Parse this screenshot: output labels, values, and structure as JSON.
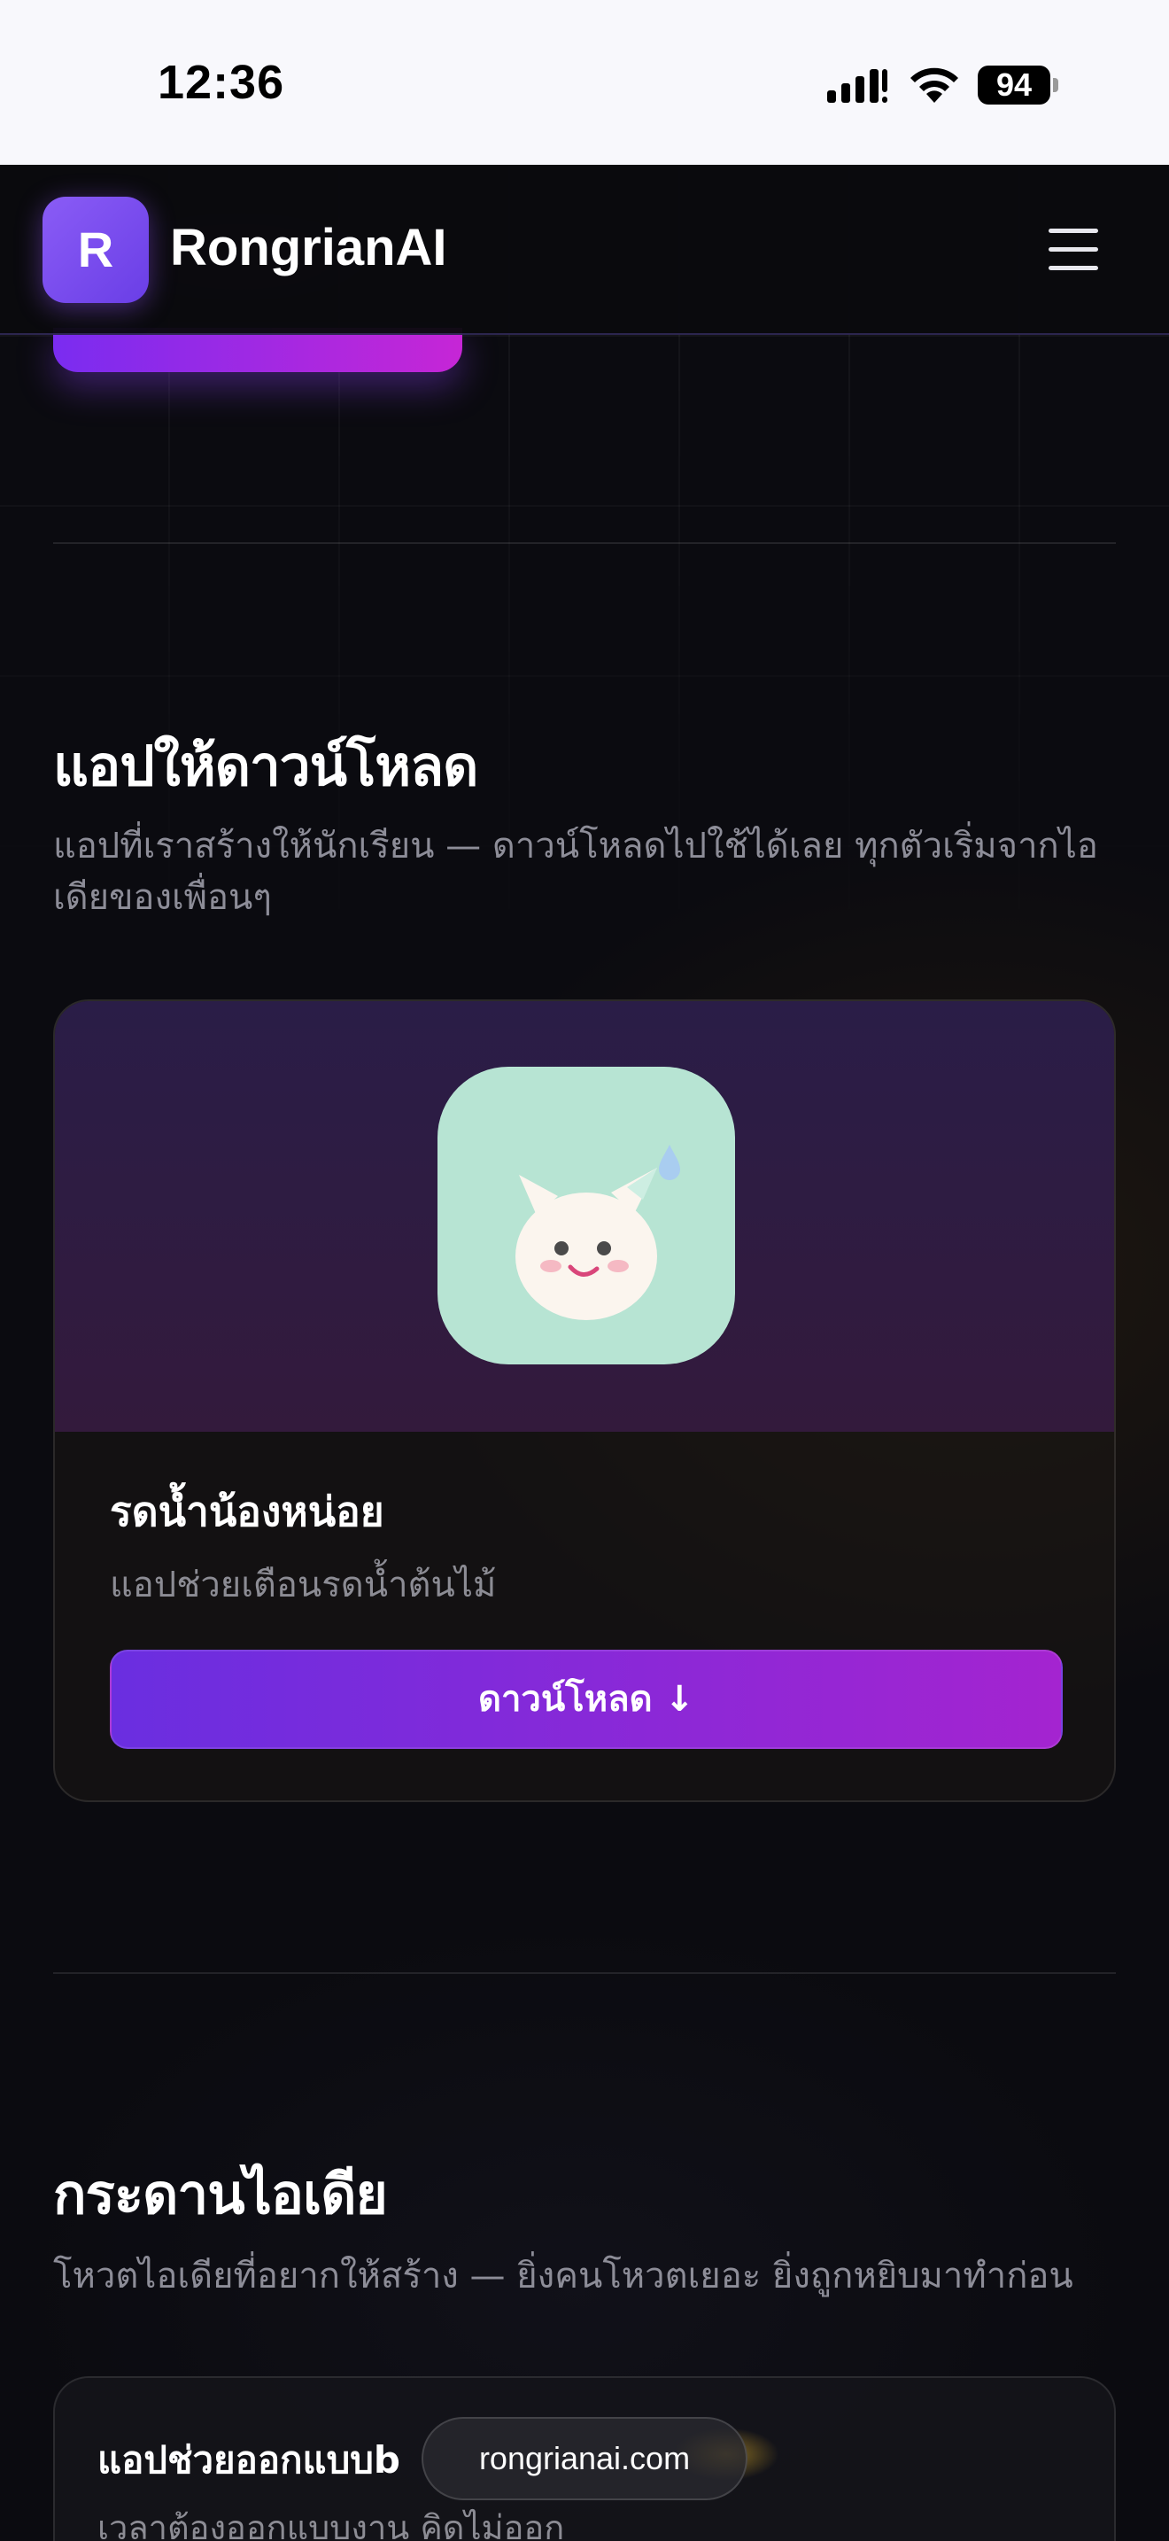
{
  "status_bar": {
    "time": "12:36",
    "battery": "94",
    "icons": [
      "signal-icon",
      "wifi-icon",
      "battery-icon"
    ]
  },
  "header": {
    "logo_letter": "R",
    "brand": "RongrianAI",
    "menu_icon": "hamburger-menu-icon"
  },
  "apps_section": {
    "title": "แอปให้ดาวน์โหลด",
    "description": "แอปที่เราสร้างให้นักเรียน — ดาวน์โหลดไปใช้ได้เลย ทุกตัวเริ่มจากไอเดียของเพื่อนๆ",
    "apps": [
      {
        "name": "รดน้ำน้องหน่อย",
        "description": "แอปช่วยเตือนรดน้ำต้นไม้",
        "download_label": "ดาวน์โหลด ↓",
        "icon": "cat-app-icon",
        "icon_bg": "#b7e4d3"
      }
    ]
  },
  "ideas_section": {
    "title": "กระดานไอเดีย",
    "description": "โหวตไอเดียที่อยากให้สร้าง — ยิ่งคนโหวตเยอะ ยิ่งถูกหยิบมาทำก่อน",
    "ideas": [
      {
        "title": "แอปช่วยออกแบบb",
        "description": "เวลาต้องออกแบบงาน คิดไม่ออก"
      }
    ]
  },
  "browser": {
    "url": "rongrianai.com"
  },
  "colors": {
    "accent_start": "#6a2ee0",
    "accent_end": "#a424d0",
    "background": "#0b0b10"
  }
}
